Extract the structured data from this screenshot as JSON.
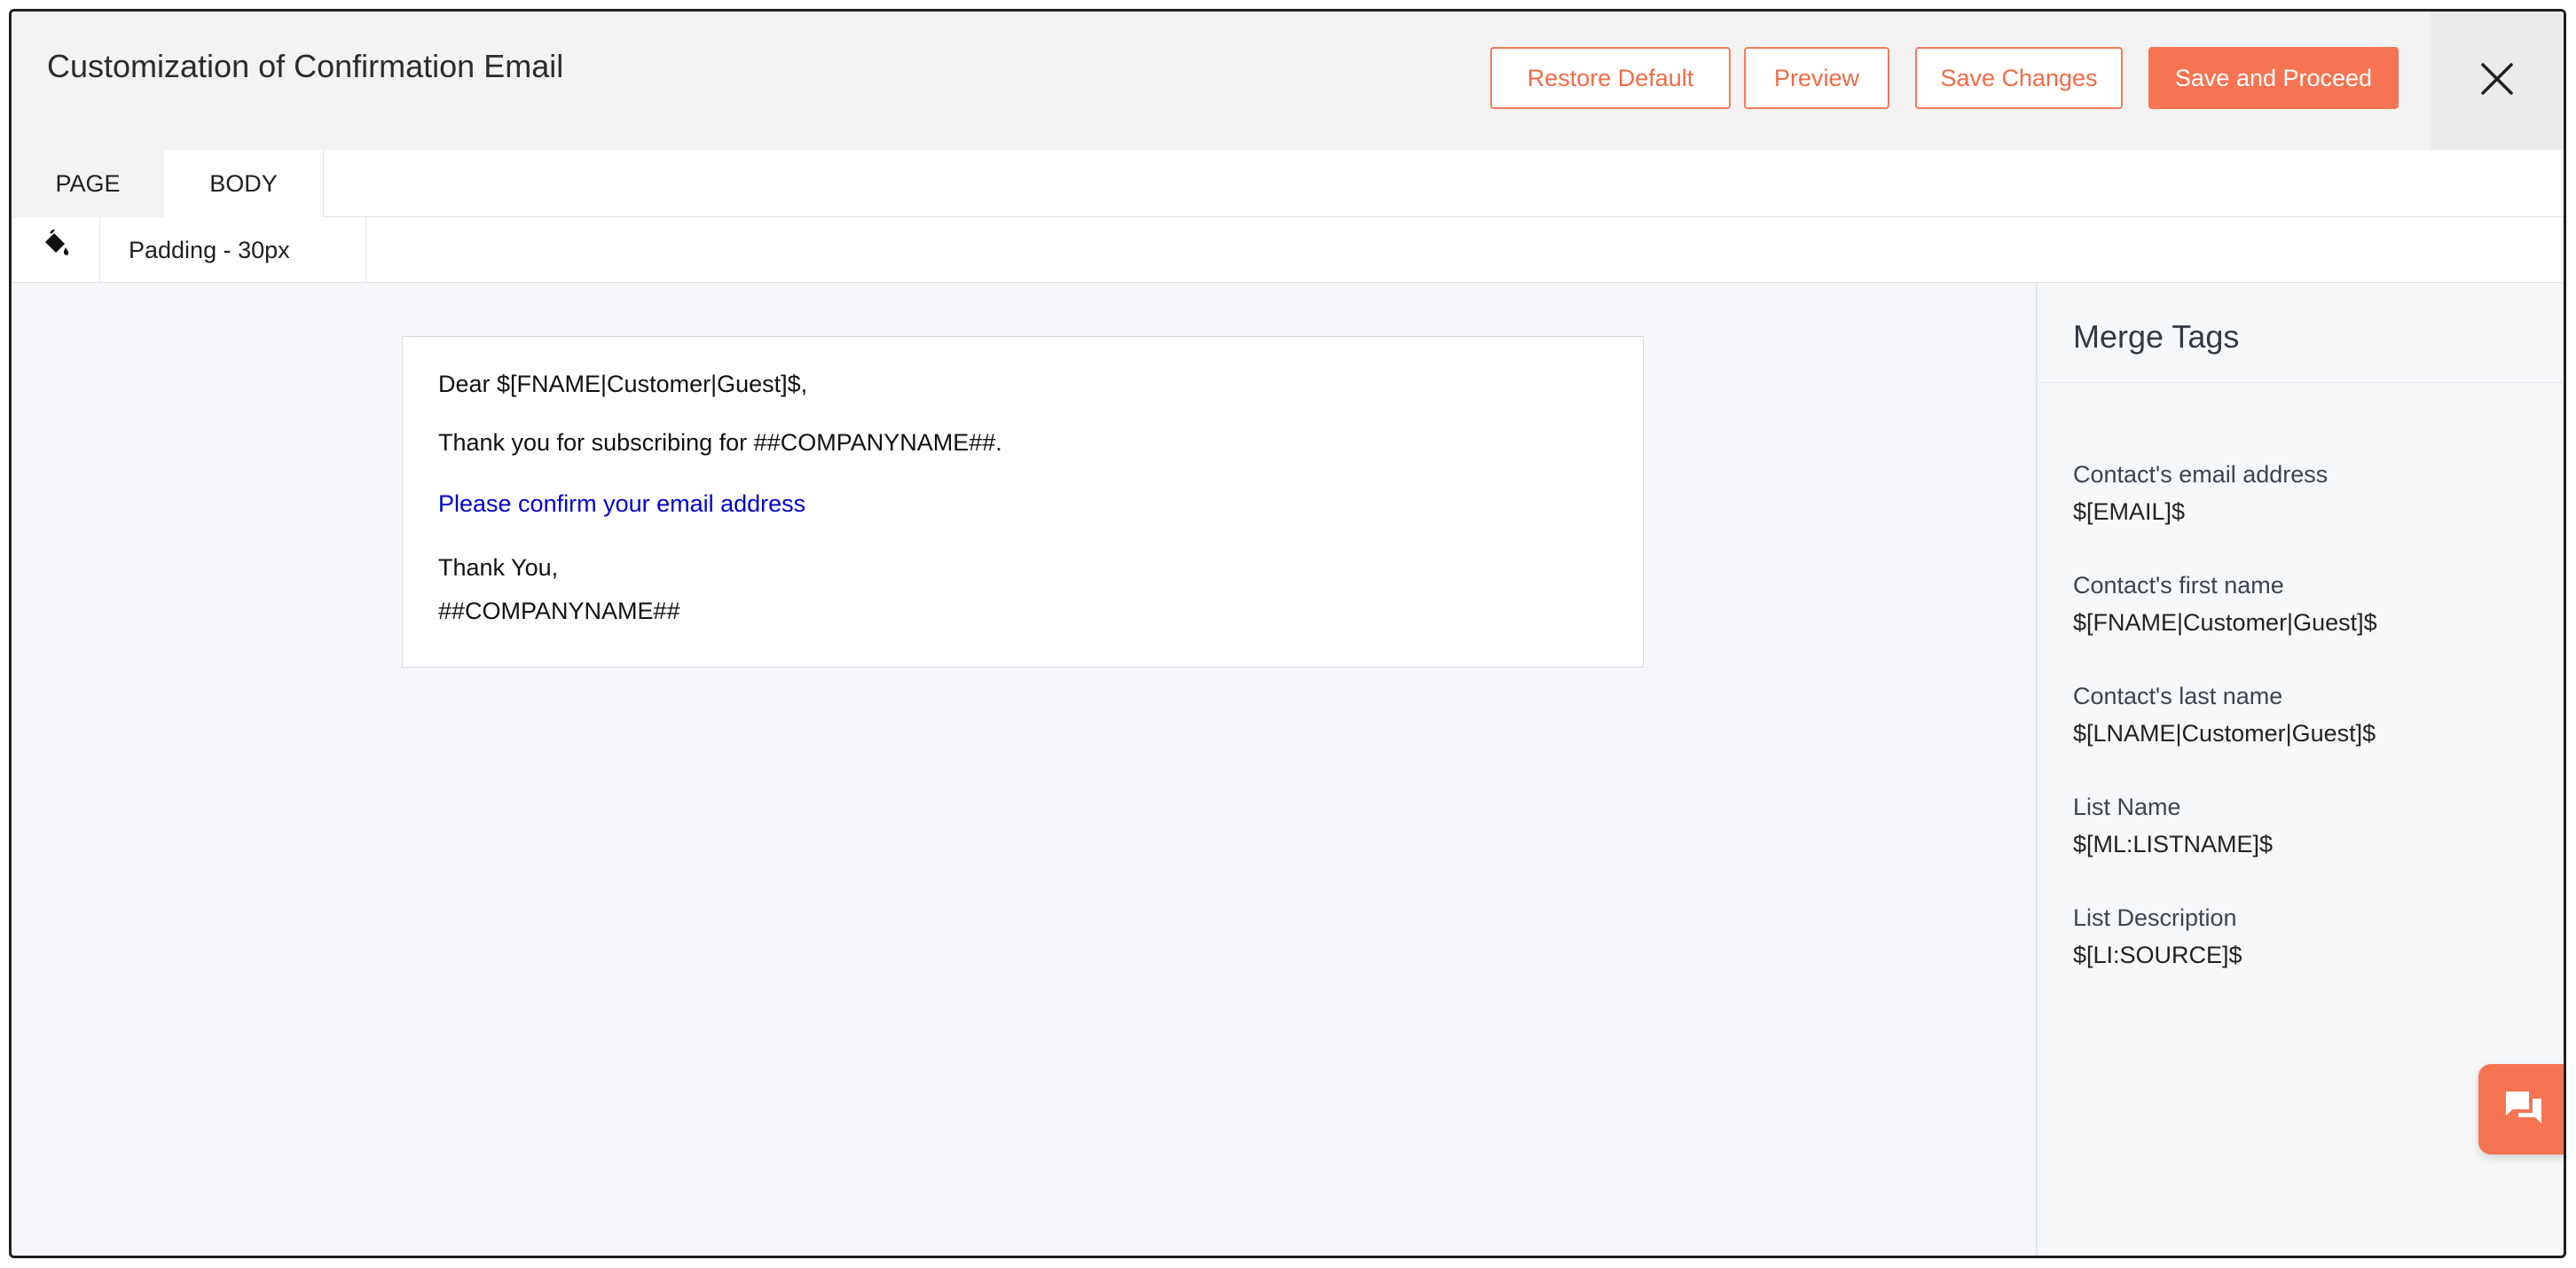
{
  "header": {
    "title": "Customization of Confirmation Email",
    "buttons": {
      "restore_default": "Restore Default",
      "preview": "Preview",
      "save_changes": "Save Changes",
      "save_and_proceed": "Save and Proceed"
    },
    "close_icon": "close-icon"
  },
  "tabs": [
    {
      "label": "PAGE",
      "active": true
    },
    {
      "label": "BODY",
      "active": false
    }
  ],
  "toolbar": {
    "paint_icon": "paint-bucket-icon",
    "padding_label": "Padding  - 30px"
  },
  "email": {
    "greeting": "Dear $[FNAME|Customer|Guest]$,",
    "thanks": "Thank you for subscribing for ##COMPANYNAME##.",
    "confirm_link": "Please confirm your email address",
    "signoff": "Thank You,",
    "company": "##COMPANYNAME##"
  },
  "merge_tags": {
    "title": "Merge Tags",
    "items": [
      {
        "label": "Contact's email address",
        "tag": "$[EMAIL]$"
      },
      {
        "label": "Contact's first name",
        "tag": "$[FNAME|Customer|Guest]$"
      },
      {
        "label": "Contact's last name",
        "tag": "$[LNAME|Customer|Guest]$"
      },
      {
        "label": "List Name",
        "tag": "$[ML:LISTNAME]$"
      },
      {
        "label": "List Description",
        "tag": "$[LI:SOURCE]$"
      }
    ]
  },
  "chat_widget": {
    "icon": "chat-icon"
  },
  "colors": {
    "accent": "#f77452",
    "link": "#0000cc",
    "header_bg": "#f3f3f3",
    "canvas_bg": "#f5f7fa"
  }
}
